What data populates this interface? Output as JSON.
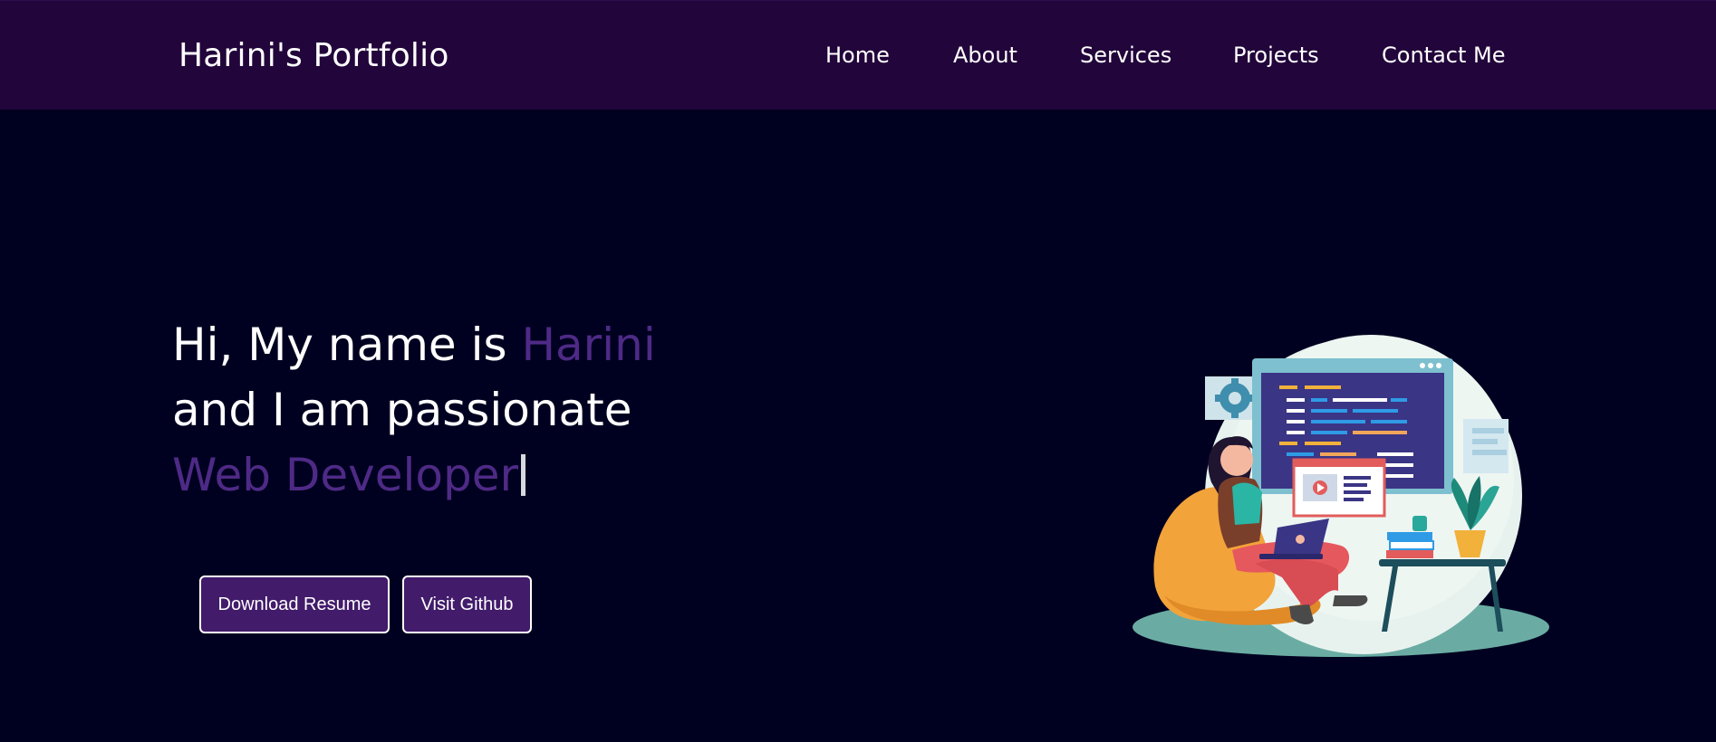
{
  "navbar": {
    "brand": "Harini's Portfolio",
    "links": [
      {
        "label": "Home"
      },
      {
        "label": "About"
      },
      {
        "label": "Services"
      },
      {
        "label": "Projects"
      },
      {
        "label": "Contact Me"
      }
    ]
  },
  "hero": {
    "line1_prefix": "Hi, My name is ",
    "name": "Harini",
    "line2": "and I am passionate",
    "role": "Web Developer",
    "accent_color": "#4e2a86"
  },
  "buttons": {
    "download_resume": "Download Resume",
    "visit_github": "Visit Github"
  },
  "illustration": {
    "icon": "developer-at-laptop-illustration"
  },
  "colors": {
    "navbar_bg": "#22053b",
    "page_bg": "#000020",
    "button_bg": "#421b6b"
  }
}
